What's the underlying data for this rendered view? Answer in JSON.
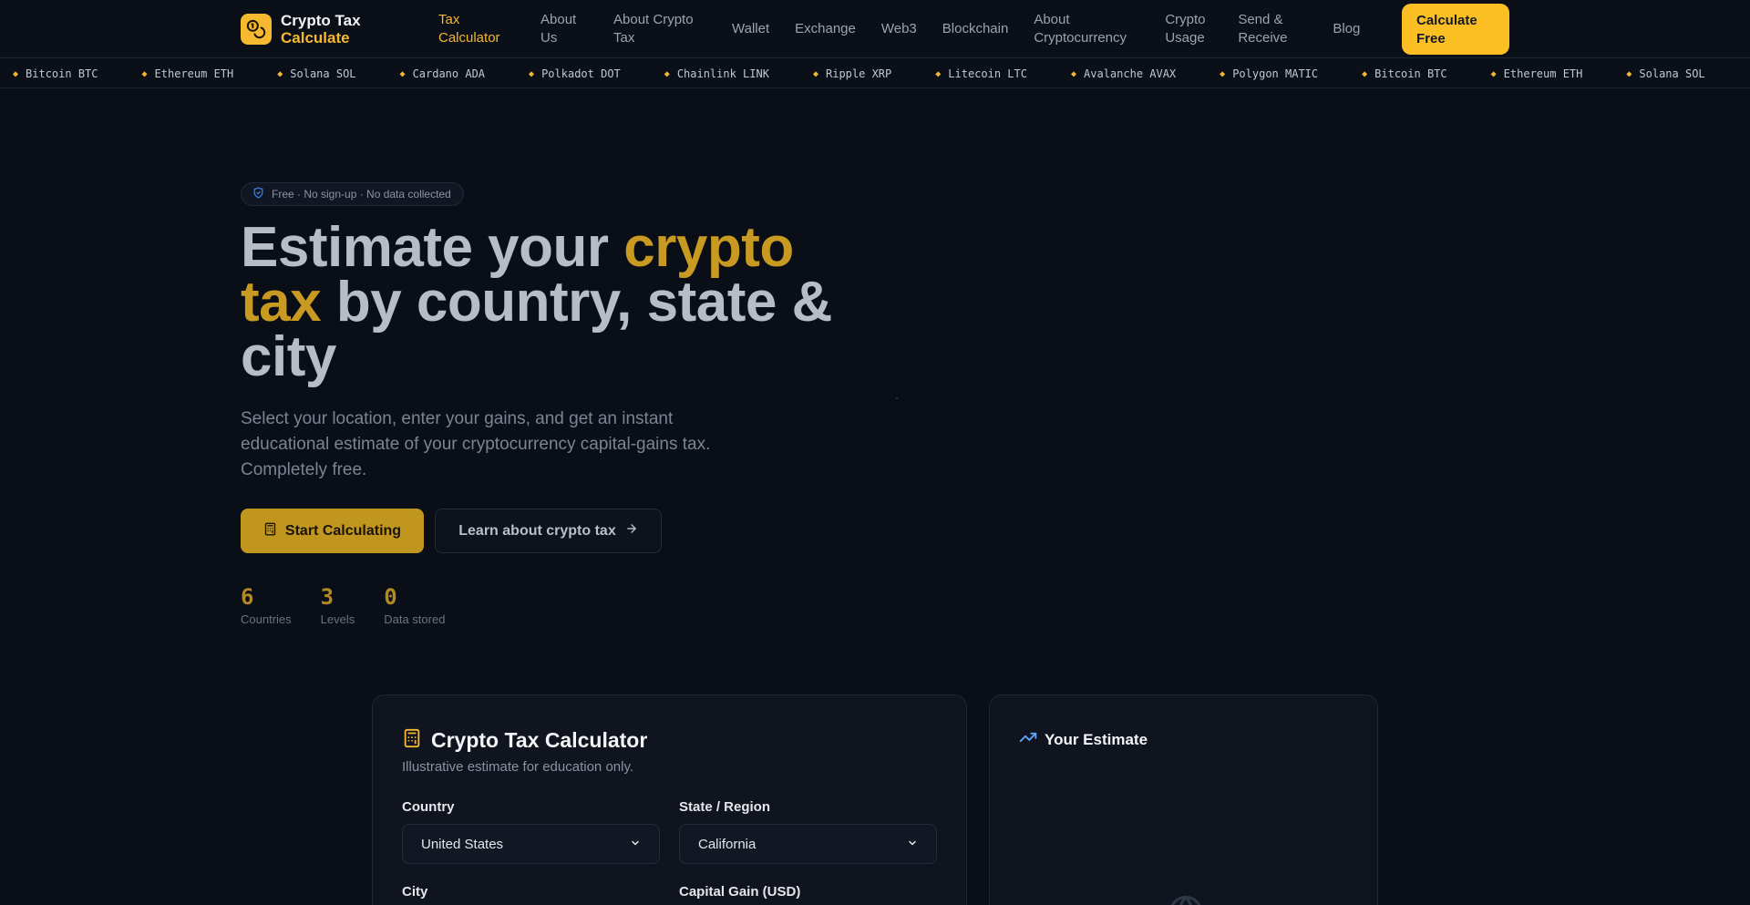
{
  "brand": {
    "line1": "Crypto Tax",
    "line2": "Calculate"
  },
  "nav": {
    "items": [
      {
        "label": "Tax Calculator",
        "active": true
      },
      {
        "label": "About Us"
      },
      {
        "label": "About Crypto Tax"
      },
      {
        "label": "Wallet"
      },
      {
        "label": "Exchange"
      },
      {
        "label": "Web3"
      },
      {
        "label": "Blockchain"
      },
      {
        "label": "About Cryptocurrency"
      },
      {
        "label": "Crypto Usage"
      },
      {
        "label": "Send & Receive"
      },
      {
        "label": "Blog"
      }
    ],
    "cta": "Calculate Free"
  },
  "ticker": [
    "Bitcoin BTC",
    "Ethereum ETH",
    "Solana SOL",
    "Cardano ADA",
    "Polkadot DOT",
    "Chainlink LINK",
    "Ripple XRP",
    "Litecoin LTC",
    "Avalanche AVAX",
    "Polygon MATIC",
    "Bitcoin BTC",
    "Ethereum ETH",
    "Solana SOL"
  ],
  "hero": {
    "badge": "Free · No sign-up · No data collected",
    "title_part1": "Estimate your ",
    "title_highlight": "crypto tax",
    "title_part2": " by country, state & city",
    "subtitle": "Select your location, enter your gains, and get an instant educational estimate of your cryptocurrency capital-gains tax. Completely free.",
    "primary_button": "Start Calculating",
    "secondary_button": "Learn about crypto tax",
    "stats": [
      {
        "value": "6",
        "label": "Countries"
      },
      {
        "value": "3",
        "label": "Levels"
      },
      {
        "value": "0",
        "label": "Data stored"
      }
    ]
  },
  "calculator": {
    "title": "Crypto Tax Calculator",
    "subtitle": "Illustrative estimate for education only.",
    "country_label": "Country",
    "country_value": "United States",
    "state_label": "State / Region",
    "state_value": "California",
    "city_label": "City",
    "gain_label": "Capital Gain (USD)"
  },
  "estimate": {
    "title": "Your Estimate"
  },
  "colors": {
    "accent": "#fbbf24",
    "background": "#0a0e17",
    "card": "#0f141e",
    "trend_icon": "#60a5fa"
  },
  "icons": {
    "brand": "coins-icon",
    "badge": "shield-check-icon",
    "primary_button": "calculator-icon",
    "secondary_button": "arrow-right-icon",
    "select": "chevron-down-icon",
    "estimate": "trending-up-icon",
    "placeholder": "globe-icon"
  }
}
